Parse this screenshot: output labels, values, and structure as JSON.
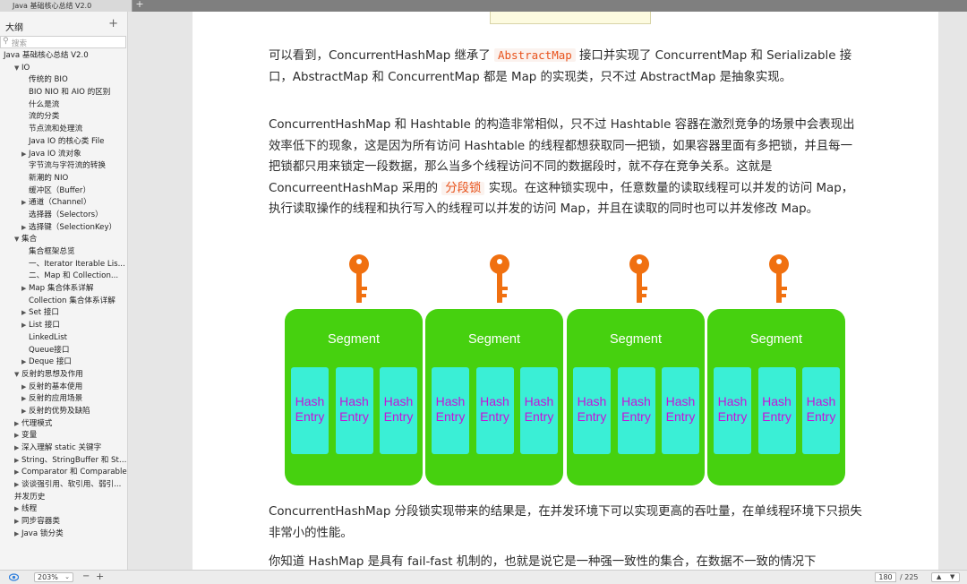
{
  "tab": {
    "title": "Java 基础核心总结 V2.0",
    "new_tab": "+"
  },
  "sidebar": {
    "header": "大纲",
    "add": "+",
    "search_placeholder": "搜索",
    "items": [
      {
        "label": "Java 基础核心总结 V2.0",
        "arrow": "",
        "level": 0
      },
      {
        "label": "IO",
        "arrow": "▼",
        "level": 1
      },
      {
        "label": "传统的 BIO",
        "arrow": "",
        "level": 2
      },
      {
        "label": "BIO NIO 和 AIO 的区别",
        "arrow": "",
        "level": 2
      },
      {
        "label": "什么是流",
        "arrow": "",
        "level": 2
      },
      {
        "label": "流的分类",
        "arrow": "",
        "level": 2
      },
      {
        "label": "节点流和处理流",
        "arrow": "",
        "level": 2
      },
      {
        "label": "Java IO 的核心类 File",
        "arrow": "",
        "level": 2
      },
      {
        "label": "Java IO 流对象",
        "arrow": "▶",
        "level": 2
      },
      {
        "label": "字节流与字符流的转换",
        "arrow": "",
        "level": 2
      },
      {
        "label": "新潮的 NIO",
        "arrow": "",
        "level": 2
      },
      {
        "label": "缓冲区（Buffer）",
        "arrow": "",
        "level": 2
      },
      {
        "label": "通道（Channel）",
        "arrow": "▶",
        "level": 2
      },
      {
        "label": "选择器（Selectors）",
        "arrow": "",
        "level": 2
      },
      {
        "label": "选择键（SelectionKey）",
        "arrow": "▶",
        "level": 2
      },
      {
        "label": "集合",
        "arrow": "▼",
        "level": 1
      },
      {
        "label": "集合框架总览",
        "arrow": "",
        "level": 2
      },
      {
        "label": "一、Iterator Iterable Lis...",
        "arrow": "",
        "level": 2
      },
      {
        "label": "二、Map 和 Collection...",
        "arrow": "",
        "level": 2
      },
      {
        "label": "Map 集合体系详解",
        "arrow": "▶",
        "level": 2
      },
      {
        "label": "Collection 集合体系详解",
        "arrow": "",
        "level": 2
      },
      {
        "label": "Set 接口",
        "arrow": "▶",
        "level": 2
      },
      {
        "label": "List 接口",
        "arrow": "▶",
        "level": 2
      },
      {
        "label": "LinkedList",
        "arrow": "",
        "level": 2
      },
      {
        "label": "Queue接口",
        "arrow": "",
        "level": 2
      },
      {
        "label": "Deque 接口",
        "arrow": "▶",
        "level": 2
      },
      {
        "label": "反射的思想及作用",
        "arrow": "▼",
        "level": 1
      },
      {
        "label": "反射的基本使用",
        "arrow": "▶",
        "level": 2
      },
      {
        "label": "反射的应用场景",
        "arrow": "▶",
        "level": 2
      },
      {
        "label": "反射的优势及缺陷",
        "arrow": "▶",
        "level": 2
      },
      {
        "label": "代理模式",
        "arrow": "▶",
        "level": 1
      },
      {
        "label": "变量",
        "arrow": "▶",
        "level": 1
      },
      {
        "label": "深入理解 static 关键字",
        "arrow": "▶",
        "level": 1
      },
      {
        "label": "String、StringBuffer 和 Stri...",
        "arrow": "▶",
        "level": 1
      },
      {
        "label": "Comparator 和 Comparable",
        "arrow": "▶",
        "level": 1
      },
      {
        "label": "谈谈强引用、软引用、弱引...",
        "arrow": "▶",
        "level": 1
      },
      {
        "label": "并发历史",
        "arrow": "",
        "level": 1
      },
      {
        "label": "线程",
        "arrow": "▶",
        "level": 1
      },
      {
        "label": "同步容器类",
        "arrow": "▶",
        "level": 1
      },
      {
        "label": "Java 锁分类",
        "arrow": "▶",
        "level": 1
      }
    ]
  },
  "content": {
    "p1_a": "可以看到，ConcurrentHashMap 继承了 ",
    "p1_code": "AbstractMap",
    "p1_b": " 接口并实现了 ConcurrentMap 和 Serializable 接口，AbstractMap 和 ConcurrentMap 都是 Map 的实现类，只不过 AbstractMap 是抽象实现。",
    "p2_a": "ConcurrentHashMap 和 Hashtable 的构造非常相似，只不过 Hashtable 容器在激烈竞争的场景中会表现出效率低下的现象，这是因为所有访问 Hashtable 的线程都想获取同一把锁，如果容器里面有多把锁，并且每一把锁都只用来锁定一段数据，那么当多个线程访问不同的数据段时，就不存在竞争关系。这就是 ConcurreentHashMap 采用的 ",
    "p2_code": "分段锁",
    "p2_b": " 实现。在这种锁实现中，任意数量的读取线程可以并发的访问 Map，执行读取操作的线程和执行写入的线程可以并发的访问 Map，并且在读取的同时也可以并发修改 Map。",
    "p3": "ConcurrentHashMap 分段锁实现带来的结果是，在并发环境下可以实现更高的吞吐量，在单线程环境下只损失非常小的性能。",
    "p4": "你知道 HashMap 是具有 fail-fast 机制的，也就是说它是一种强一致性的集合，在数据不一致的情况下"
  },
  "diagram": {
    "segment_label": "Segment",
    "entry_line1": "Hash",
    "entry_line2": "Entry",
    "segment_count": 4,
    "entries_per_segment": 3,
    "colors": {
      "segment": "#46d10f",
      "entry": "#3aefd6",
      "entry_text": "#c513d9",
      "key": "#f07010"
    }
  },
  "statusbar": {
    "zoom": "203%",
    "zoom_out": "−",
    "zoom_in": "+",
    "page_current": "180",
    "page_total": "/ 225",
    "up": "▲",
    "down": "▼"
  }
}
